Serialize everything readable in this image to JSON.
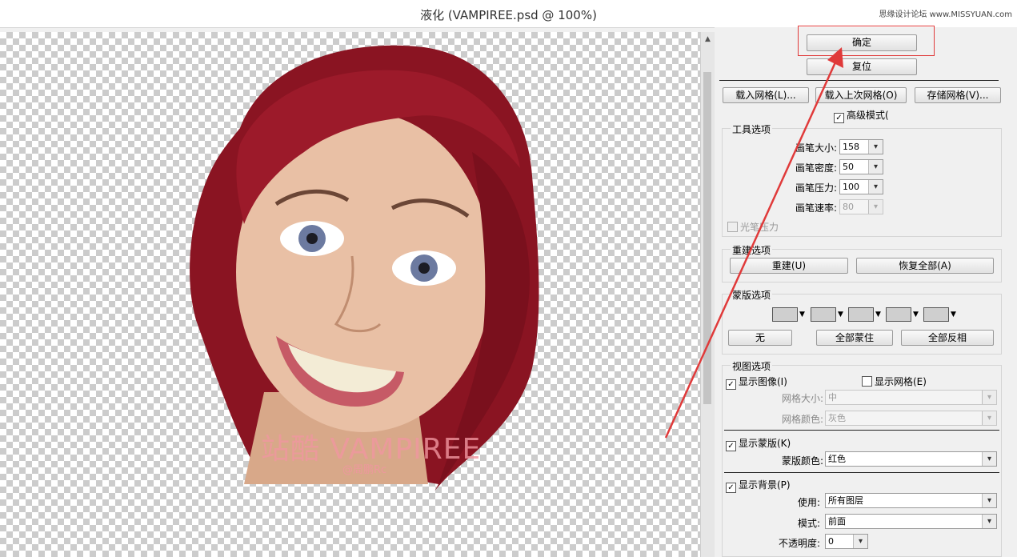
{
  "window": {
    "title": "液化 (VAMPIREE.psd @ 100%)",
    "watermark": "思缘设计论坛 www.MISSYUAN.com"
  },
  "canvas": {
    "overlay_text": "站酷 VAMPIREE",
    "overlay_sub": "@周鹏Rc"
  },
  "buttons": {
    "ok": "确定",
    "reset": "复位",
    "load_mesh": "载入网格(L)...",
    "load_last_mesh": "载入上次网格(O)",
    "save_mesh": "存储网格(V)..."
  },
  "advanced_mode": {
    "label": "高级模式(",
    "checked": true
  },
  "tool_options": {
    "legend": "工具选项",
    "brush_size": {
      "label": "画笔大小:",
      "value": "158"
    },
    "brush_density": {
      "label": "画笔密度:",
      "value": "50"
    },
    "brush_pressure": {
      "label": "画笔压力:",
      "value": "100"
    },
    "brush_rate": {
      "label": "画笔速率:",
      "value": "80"
    },
    "stylus_pressure": {
      "label": "光笔压力",
      "checked": false
    }
  },
  "reconstruct": {
    "legend": "重建选项",
    "reconstruct_btn": "重建(U)",
    "restore_all_btn": "恢复全部(A)"
  },
  "mask": {
    "legend": "蒙版选项",
    "none_btn": "无",
    "mask_all_btn": "全部蒙住",
    "invert_all_btn": "全部反相"
  },
  "view": {
    "legend": "视图选项",
    "show_image": {
      "label": "显示图像(I)",
      "checked": true
    },
    "show_mesh": {
      "label": "显示网格(E)",
      "checked": false
    },
    "mesh_size": {
      "label": "网格大小:",
      "value": "中"
    },
    "mesh_color": {
      "label": "网格颜色:",
      "value": "灰色"
    },
    "show_mask": {
      "label": "显示蒙版(K)",
      "checked": true
    },
    "mask_color": {
      "label": "蒙版颜色:",
      "value": "红色"
    },
    "show_backdrop": {
      "label": "显示背景(P)",
      "checked": true
    },
    "use": {
      "label": "使用:",
      "value": "所有图层"
    },
    "mode": {
      "label": "模式:",
      "value": "前面"
    },
    "opacity": {
      "label": "不透明度:",
      "value": "0"
    }
  },
  "colors": {
    "annotation_red": "#e03a3a",
    "hair": "#8a1422",
    "skin": "#e9c0a5"
  },
  "icons": [
    "mask-replace-icon",
    "mask-add-icon",
    "mask-subtract-icon",
    "mask-intersect-icon",
    "mask-invert-icon",
    "dropdown-arrow-icon",
    "checkmark-icon",
    "scroll-up-icon"
  ]
}
